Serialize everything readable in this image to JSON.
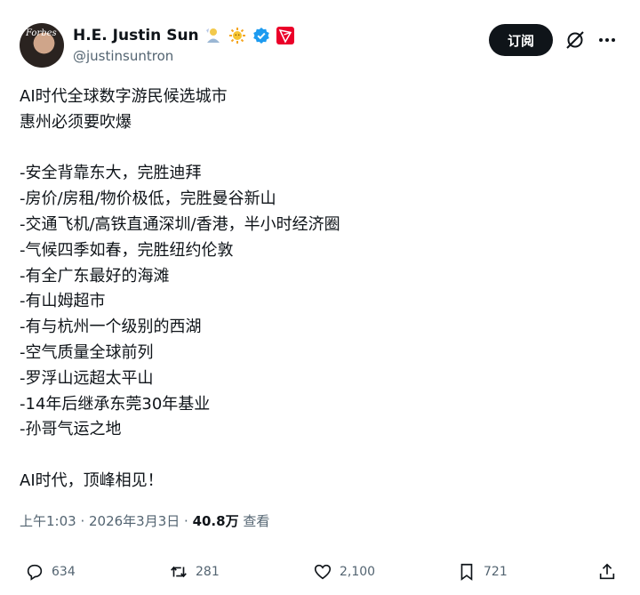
{
  "author": {
    "name": "H.E. Justin Sun",
    "handle": "@justinsuntron",
    "avatar_text": "Forbes",
    "badges": [
      "person-emoji-icon",
      "sun-emoji-icon",
      "verified-icon",
      "tron-logo-icon"
    ]
  },
  "header": {
    "subscribe_label": "订阅",
    "grok_icon": "grok-icon",
    "more_icon": "more-icon"
  },
  "post": {
    "lines": [
      "AI时代全球数字游民候选城市",
      "惠州必须要吹爆",
      "",
      "-安全背靠东大，完胜迪拜",
      "-房价/房租/物价极低，完胜曼谷新山",
      "-交通飞机/高铁直通深圳/香港，半小时经济圈",
      "-气候四季如春，完胜纽约伦敦",
      "-有全广东最好的海滩",
      "-有山姆超市",
      "-有与杭州一个级别的西湖",
      "-空气质量全球前列",
      "-罗浮山远超太平山",
      "-14年后继承东莞30年基业",
      "-孙哥气运之地",
      "",
      "AI时代，顶峰相见！"
    ]
  },
  "meta": {
    "timestamp": "上午1:03 · 2026年3月3日 · ",
    "views_count": "40.8万",
    "views_label": " 查看"
  },
  "actions": {
    "replies": "634",
    "reposts": "281",
    "likes": "2,100",
    "bookmarks": "721"
  },
  "colors": {
    "text": "#0f1419",
    "secondary": "#536471",
    "verified": "#1d9bf0",
    "tron": "#eb0029",
    "button_bg": "#0f1419"
  }
}
